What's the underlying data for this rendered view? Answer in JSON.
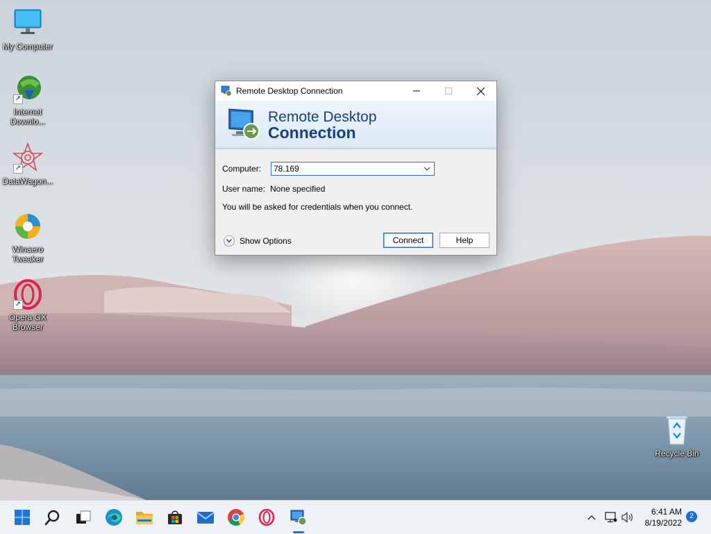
{
  "desktop": {
    "icons": [
      {
        "label": "My Computer"
      },
      {
        "label": "Internet Downlo..."
      },
      {
        "label": "DataWagon..."
      },
      {
        "label": "Winaero Tweaker"
      },
      {
        "label": "Opera GX Browser"
      },
      {
        "label": "Recycle Bin"
      }
    ]
  },
  "dialog": {
    "title": "Remote Desktop Connection",
    "banner_line1": "Remote Desktop",
    "banner_line2": "Connection",
    "computer_label": "Computer:",
    "computer_value": "78.169",
    "username_label": "User name:",
    "username_value": "None specified",
    "credentials_note": "You will be asked for credentials when you connect.",
    "show_options_label": "Show Options",
    "connect_label": "Connect",
    "help_label": "Help"
  },
  "taskbar": {
    "apps": [
      "start-icon",
      "search-icon",
      "task-view-icon",
      "edge-icon",
      "file-explorer-icon",
      "store-icon",
      "mail-icon",
      "chrome-icon",
      "opera-gx-icon",
      "remote-desktop-icon"
    ],
    "active_app": "remote-desktop-icon",
    "time": "6:41 AM",
    "date": "8/19/2022",
    "notification_count": "2"
  },
  "colors": {
    "accent": "#1d6fd1",
    "banner_text": "#1a3f7a",
    "dialog_bg": "#f0f0f0"
  }
}
